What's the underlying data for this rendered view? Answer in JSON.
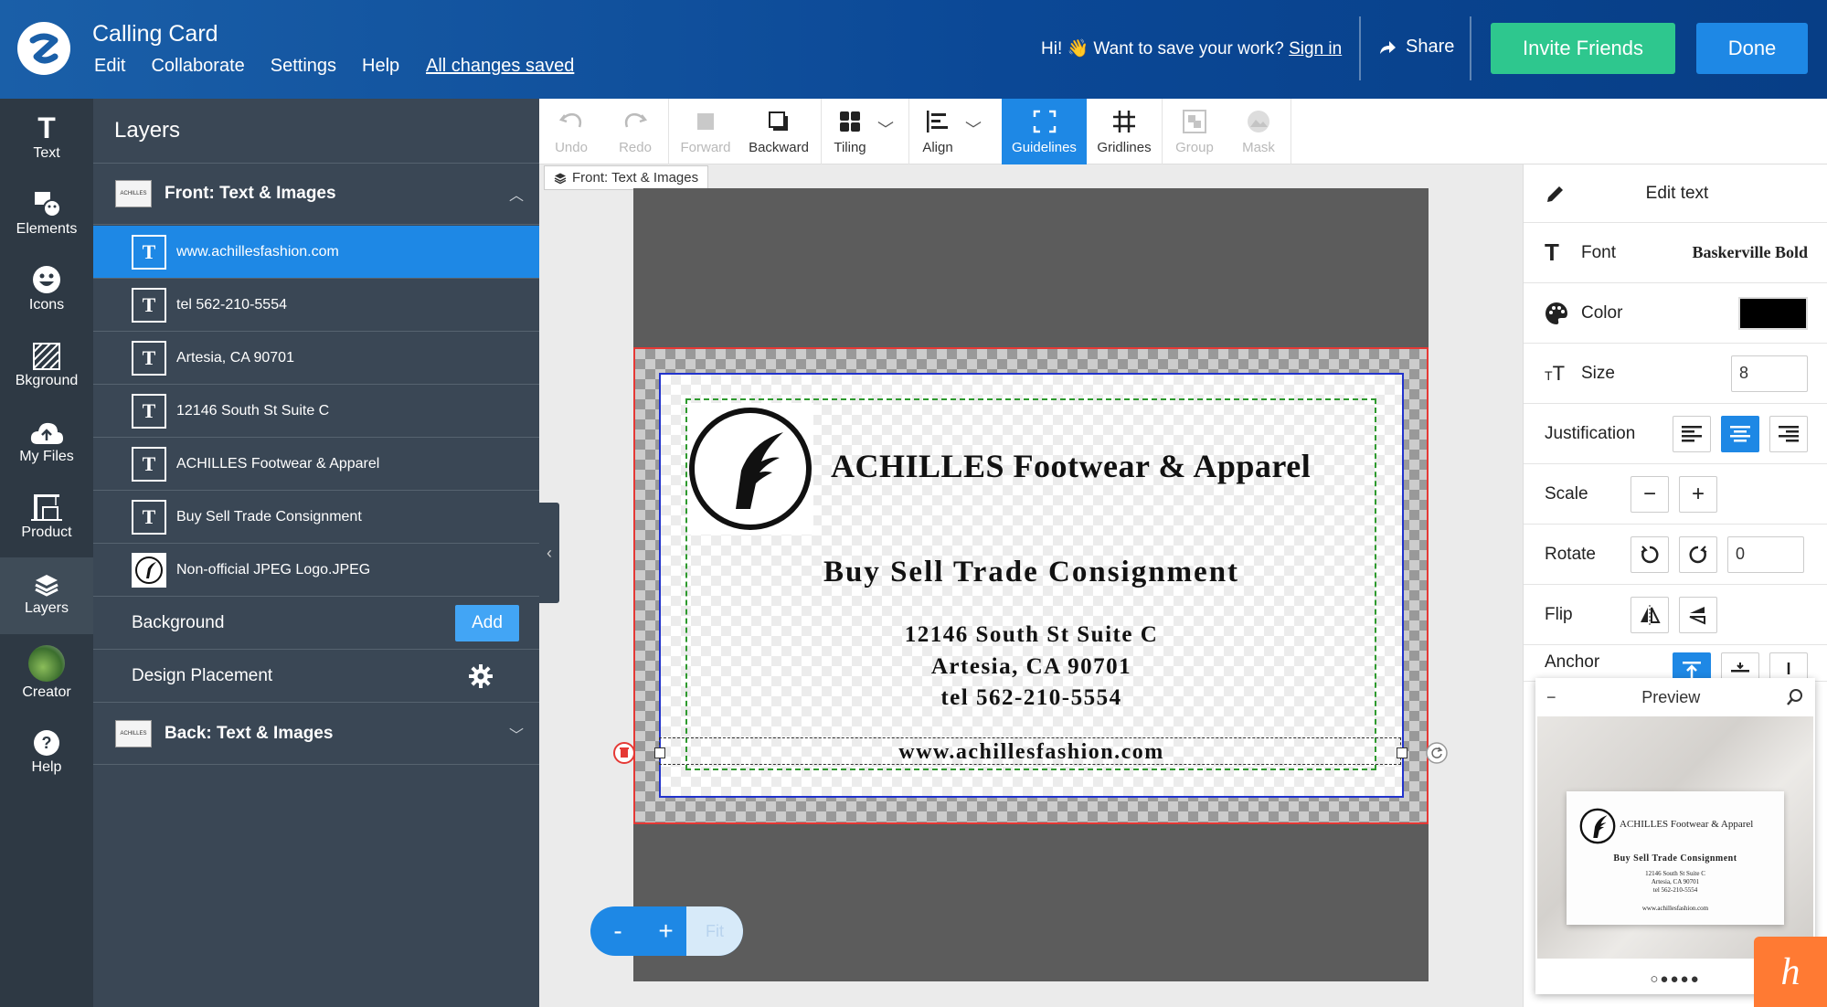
{
  "header": {
    "title": "Calling Card",
    "menu": [
      "Edit",
      "Collaborate",
      "Settings",
      "Help"
    ],
    "saved_status": "All changes saved",
    "greeting": "Hi! 👋 Want to save your work?",
    "sign_in": "Sign in",
    "share": "Share",
    "invite": "Invite Friends",
    "done": "Done"
  },
  "leftnav": [
    {
      "label": "Text",
      "icon": "text-icon"
    },
    {
      "label": "Elements",
      "icon": "shapes-icon"
    },
    {
      "label": "Icons",
      "icon": "smiley-icon"
    },
    {
      "label": "Bkground",
      "icon": "background-pattern-icon"
    },
    {
      "label": "My Files",
      "icon": "cloud-upload-icon"
    },
    {
      "label": "Product",
      "icon": "crane-icon"
    },
    {
      "label": "Layers",
      "icon": "layers-icon"
    },
    {
      "label": "Creator",
      "icon": "creator-avatar"
    },
    {
      "label": "Help",
      "icon": "help-icon"
    }
  ],
  "layers": {
    "title": "Layers",
    "front_section": "Front: Text & Images",
    "items": [
      {
        "label": "www.achillesfashion.com",
        "type": "text",
        "selected": true
      },
      {
        "label": "tel 562-210-5554",
        "type": "text"
      },
      {
        "label": "Artesia, CA 90701",
        "type": "text"
      },
      {
        "label": "12146 South St Suite C",
        "type": "text"
      },
      {
        "label": "ACHILLES Footwear & Apparel",
        "type": "text"
      },
      {
        "label": "Buy Sell Trade Consignment",
        "type": "text"
      },
      {
        "label": "Non-official JPEG Logo.JPEG",
        "type": "image"
      }
    ],
    "background_label": "Background",
    "add_label": "Add",
    "design_placement": "Design Placement",
    "back_section": "Back: Text & Images",
    "thumb_text": "ACHILLES"
  },
  "toolbar": {
    "tools": [
      {
        "label": "Undo",
        "icon": "undo-icon"
      },
      {
        "label": "Redo",
        "icon": "redo-icon"
      },
      {
        "label": "Forward",
        "icon": "bring-forward-icon"
      },
      {
        "label": "Backward",
        "icon": "send-backward-icon"
      },
      {
        "label": "Tiling",
        "icon": "tiling-icon"
      },
      {
        "label": "Align",
        "icon": "align-icon"
      },
      {
        "label": "Guidelines",
        "icon": "guidelines-icon"
      },
      {
        "label": "Gridlines",
        "icon": "gridlines-icon"
      },
      {
        "label": "Group",
        "icon": "group-icon"
      },
      {
        "label": "Mask",
        "icon": "mask-icon"
      }
    ]
  },
  "breadcrumb": "Front: Text & Images",
  "card": {
    "title": "ACHILLES Footwear & Apparel",
    "tagline": "Buy Sell Trade Consignment",
    "address1": "12146 South St Suite C",
    "address2": "Artesia, CA 90701",
    "phone": "tel 562-210-5554",
    "website": "www.achillesfashion.com"
  },
  "zoom": {
    "minus": "-",
    "plus": "+",
    "fit": "Fit"
  },
  "edit_panel": {
    "title": "Edit text",
    "font_label": "Font",
    "font_value": "Baskerville Bold",
    "color_label": "Color",
    "color_value": "#000000",
    "size_label": "Size",
    "size_value": "8",
    "justification_label": "Justification",
    "scale_label": "Scale",
    "rotate_label": "Rotate",
    "rotate_value": "0",
    "flip_label": "Flip",
    "anchor_label": "Anchor"
  },
  "preview": {
    "title": "Preview",
    "minimize": "−",
    "dots": "○●●●●"
  },
  "help_badge": "h"
}
